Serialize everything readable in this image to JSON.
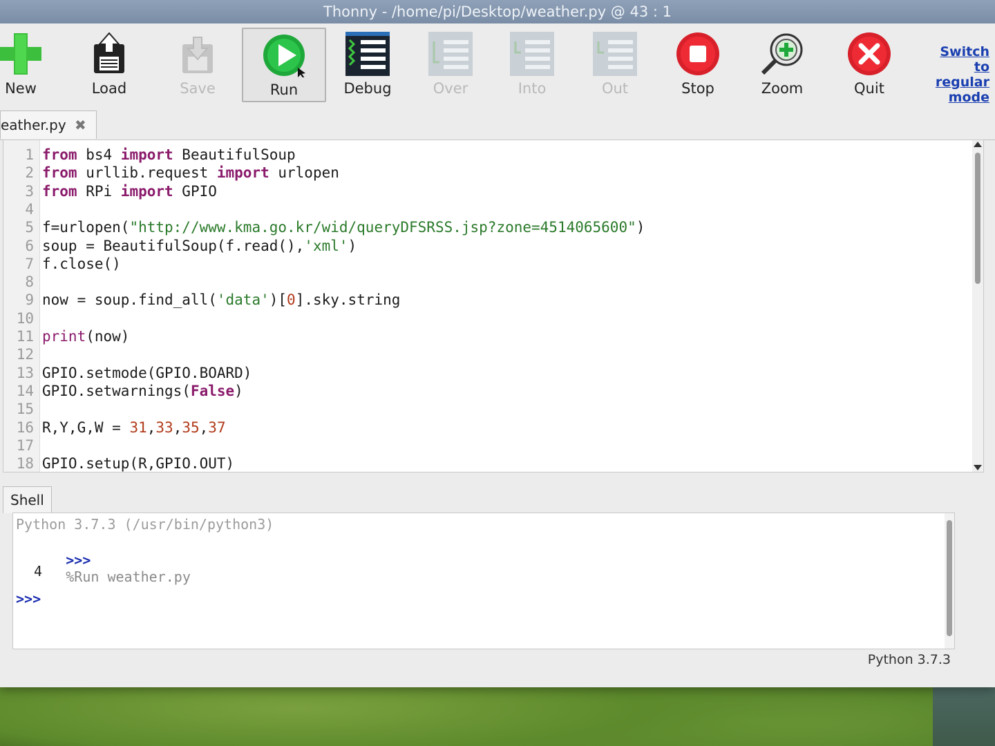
{
  "window": {
    "title": "Thonny  -  /home/pi/Desktop/weather.py  @  43 : 1"
  },
  "toolbar": {
    "buttons": [
      {
        "label": "New",
        "icon": "plus-icon",
        "enabled": true
      },
      {
        "label": "Load",
        "icon": "load-icon",
        "enabled": true
      },
      {
        "label": "Save",
        "icon": "save-icon",
        "enabled": false
      },
      {
        "label": "Run",
        "icon": "run-icon",
        "enabled": true
      },
      {
        "label": "Debug",
        "icon": "debug-icon",
        "enabled": true
      },
      {
        "label": "Over",
        "icon": "step-over-icon",
        "enabled": false
      },
      {
        "label": "Into",
        "icon": "step-into-icon",
        "enabled": false
      },
      {
        "label": "Out",
        "icon": "step-out-icon",
        "enabled": false
      },
      {
        "label": "Stop",
        "icon": "stop-icon",
        "enabled": true
      },
      {
        "label": "Zoom",
        "icon": "zoom-icon",
        "enabled": true
      },
      {
        "label": "Quit",
        "icon": "quit-icon",
        "enabled": true
      }
    ],
    "switch_mode": {
      "line1": "Switch to",
      "line2": "regular",
      "line3": "mode"
    }
  },
  "editor": {
    "tab_label": "eather.py",
    "lines": [
      {
        "n": "1",
        "code": "from bs4 import BeautifulSoup"
      },
      {
        "n": "2",
        "code": "from urllib.request import urlopen"
      },
      {
        "n": "3",
        "code": "from RPi import GPIO"
      },
      {
        "n": "4",
        "code": ""
      },
      {
        "n": "5",
        "code": "f=urlopen(\"http://www.kma.go.kr/wid/queryDFSRSS.jsp?zone=4514065600\")"
      },
      {
        "n": "6",
        "code": "soup = BeautifulSoup(f.read(),'xml')"
      },
      {
        "n": "7",
        "code": "f.close()"
      },
      {
        "n": "8",
        "code": ""
      },
      {
        "n": "9",
        "code": "now = soup.find_all('data')[0].sky.string"
      },
      {
        "n": "10",
        "code": ""
      },
      {
        "n": "11",
        "code": "print(now)"
      },
      {
        "n": "12",
        "code": ""
      },
      {
        "n": "13",
        "code": "GPIO.setmode(GPIO.BOARD)"
      },
      {
        "n": "14",
        "code": "GPIO.setwarnings(False)"
      },
      {
        "n": "15",
        "code": ""
      },
      {
        "n": "16",
        "code": "R,Y,G,W = 31,33,35,37"
      },
      {
        "n": "17",
        "code": ""
      },
      {
        "n": "18",
        "code": "GPIO.setup(R,GPIO.OUT)"
      }
    ]
  },
  "shell": {
    "tab_label": "Shell",
    "banner": "Python 3.7.3 (/usr/bin/python3)",
    "prompt": ">>>",
    "command": "%Run weather.py",
    "output": "4",
    "prompt2": ">>>"
  },
  "status": {
    "interpreter": "Python 3.7.3"
  },
  "colors": {
    "keyword": "#8a1b6b",
    "string": "#2a7a2a",
    "number": "#b03a1a",
    "prompt": "#1c2fb0"
  }
}
